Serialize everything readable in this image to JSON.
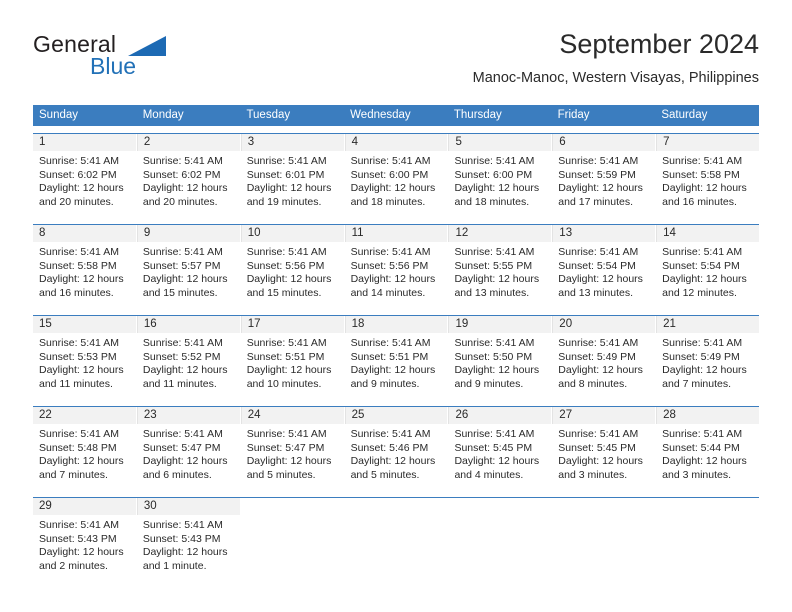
{
  "brand": {
    "word_one": "General",
    "word_two": "Blue",
    "triangle_icon": "triangle-icon",
    "accent_color": "#1d6ab4"
  },
  "header": {
    "title": "September 2024",
    "subtitle": "Manoc-Manoc, Western Visayas, Philippines"
  },
  "calendar": {
    "header_bg_color": "#3b7dbf",
    "day_band_color": "#f2f2f2",
    "weekdays": [
      "Sunday",
      "Monday",
      "Tuesday",
      "Wednesday",
      "Thursday",
      "Friday",
      "Saturday"
    ],
    "weeks": [
      {
        "days": [
          {
            "num": "1",
            "l1": "Sunrise: 5:41 AM",
            "l2": "Sunset: 6:02 PM",
            "l3": "Daylight: 12 hours",
            "l4": "and 20 minutes."
          },
          {
            "num": "2",
            "l1": "Sunrise: 5:41 AM",
            "l2": "Sunset: 6:02 PM",
            "l3": "Daylight: 12 hours",
            "l4": "and 20 minutes."
          },
          {
            "num": "3",
            "l1": "Sunrise: 5:41 AM",
            "l2": "Sunset: 6:01 PM",
            "l3": "Daylight: 12 hours",
            "l4": "and 19 minutes."
          },
          {
            "num": "4",
            "l1": "Sunrise: 5:41 AM",
            "l2": "Sunset: 6:00 PM",
            "l3": "Daylight: 12 hours",
            "l4": "and 18 minutes."
          },
          {
            "num": "5",
            "l1": "Sunrise: 5:41 AM",
            "l2": "Sunset: 6:00 PM",
            "l3": "Daylight: 12 hours",
            "l4": "and 18 minutes."
          },
          {
            "num": "6",
            "l1": "Sunrise: 5:41 AM",
            "l2": "Sunset: 5:59 PM",
            "l3": "Daylight: 12 hours",
            "l4": "and 17 minutes."
          },
          {
            "num": "7",
            "l1": "Sunrise: 5:41 AM",
            "l2": "Sunset: 5:58 PM",
            "l3": "Daylight: 12 hours",
            "l4": "and 16 minutes."
          }
        ]
      },
      {
        "days": [
          {
            "num": "8",
            "l1": "Sunrise: 5:41 AM",
            "l2": "Sunset: 5:58 PM",
            "l3": "Daylight: 12 hours",
            "l4": "and 16 minutes."
          },
          {
            "num": "9",
            "l1": "Sunrise: 5:41 AM",
            "l2": "Sunset: 5:57 PM",
            "l3": "Daylight: 12 hours",
            "l4": "and 15 minutes."
          },
          {
            "num": "10",
            "l1": "Sunrise: 5:41 AM",
            "l2": "Sunset: 5:56 PM",
            "l3": "Daylight: 12 hours",
            "l4": "and 15 minutes."
          },
          {
            "num": "11",
            "l1": "Sunrise: 5:41 AM",
            "l2": "Sunset: 5:56 PM",
            "l3": "Daylight: 12 hours",
            "l4": "and 14 minutes."
          },
          {
            "num": "12",
            "l1": "Sunrise: 5:41 AM",
            "l2": "Sunset: 5:55 PM",
            "l3": "Daylight: 12 hours",
            "l4": "and 13 minutes."
          },
          {
            "num": "13",
            "l1": "Sunrise: 5:41 AM",
            "l2": "Sunset: 5:54 PM",
            "l3": "Daylight: 12 hours",
            "l4": "and 13 minutes."
          },
          {
            "num": "14",
            "l1": "Sunrise: 5:41 AM",
            "l2": "Sunset: 5:54 PM",
            "l3": "Daylight: 12 hours",
            "l4": "and 12 minutes."
          }
        ]
      },
      {
        "days": [
          {
            "num": "15",
            "l1": "Sunrise: 5:41 AM",
            "l2": "Sunset: 5:53 PM",
            "l3": "Daylight: 12 hours",
            "l4": "and 11 minutes."
          },
          {
            "num": "16",
            "l1": "Sunrise: 5:41 AM",
            "l2": "Sunset: 5:52 PM",
            "l3": "Daylight: 12 hours",
            "l4": "and 11 minutes."
          },
          {
            "num": "17",
            "l1": "Sunrise: 5:41 AM",
            "l2": "Sunset: 5:51 PM",
            "l3": "Daylight: 12 hours",
            "l4": "and 10 minutes."
          },
          {
            "num": "18",
            "l1": "Sunrise: 5:41 AM",
            "l2": "Sunset: 5:51 PM",
            "l3": "Daylight: 12 hours",
            "l4": "and 9 minutes."
          },
          {
            "num": "19",
            "l1": "Sunrise: 5:41 AM",
            "l2": "Sunset: 5:50 PM",
            "l3": "Daylight: 12 hours",
            "l4": "and 9 minutes."
          },
          {
            "num": "20",
            "l1": "Sunrise: 5:41 AM",
            "l2": "Sunset: 5:49 PM",
            "l3": "Daylight: 12 hours",
            "l4": "and 8 minutes."
          },
          {
            "num": "21",
            "l1": "Sunrise: 5:41 AM",
            "l2": "Sunset: 5:49 PM",
            "l3": "Daylight: 12 hours",
            "l4": "and 7 minutes."
          }
        ]
      },
      {
        "days": [
          {
            "num": "22",
            "l1": "Sunrise: 5:41 AM",
            "l2": "Sunset: 5:48 PM",
            "l3": "Daylight: 12 hours",
            "l4": "and 7 minutes."
          },
          {
            "num": "23",
            "l1": "Sunrise: 5:41 AM",
            "l2": "Sunset: 5:47 PM",
            "l3": "Daylight: 12 hours",
            "l4": "and 6 minutes."
          },
          {
            "num": "24",
            "l1": "Sunrise: 5:41 AM",
            "l2": "Sunset: 5:47 PM",
            "l3": "Daylight: 12 hours",
            "l4": "and 5 minutes."
          },
          {
            "num": "25",
            "l1": "Sunrise: 5:41 AM",
            "l2": "Sunset: 5:46 PM",
            "l3": "Daylight: 12 hours",
            "l4": "and 5 minutes."
          },
          {
            "num": "26",
            "l1": "Sunrise: 5:41 AM",
            "l2": "Sunset: 5:45 PM",
            "l3": "Daylight: 12 hours",
            "l4": "and 4 minutes."
          },
          {
            "num": "27",
            "l1": "Sunrise: 5:41 AM",
            "l2": "Sunset: 5:45 PM",
            "l3": "Daylight: 12 hours",
            "l4": "and 3 minutes."
          },
          {
            "num": "28",
            "l1": "Sunrise: 5:41 AM",
            "l2": "Sunset: 5:44 PM",
            "l3": "Daylight: 12 hours",
            "l4": "and 3 minutes."
          }
        ]
      },
      {
        "days": [
          {
            "num": "29",
            "l1": "Sunrise: 5:41 AM",
            "l2": "Sunset: 5:43 PM",
            "l3": "Daylight: 12 hours",
            "l4": "and 2 minutes."
          },
          {
            "num": "30",
            "l1": "Sunrise: 5:41 AM",
            "l2": "Sunset: 5:43 PM",
            "l3": "Daylight: 12 hours",
            "l4": "and 1 minute."
          },
          {
            "num": "",
            "l1": "",
            "l2": "",
            "l3": "",
            "l4": ""
          },
          {
            "num": "",
            "l1": "",
            "l2": "",
            "l3": "",
            "l4": ""
          },
          {
            "num": "",
            "l1": "",
            "l2": "",
            "l3": "",
            "l4": ""
          },
          {
            "num": "",
            "l1": "",
            "l2": "",
            "l3": "",
            "l4": ""
          },
          {
            "num": "",
            "l1": "",
            "l2": "",
            "l3": "",
            "l4": ""
          }
        ]
      }
    ]
  }
}
